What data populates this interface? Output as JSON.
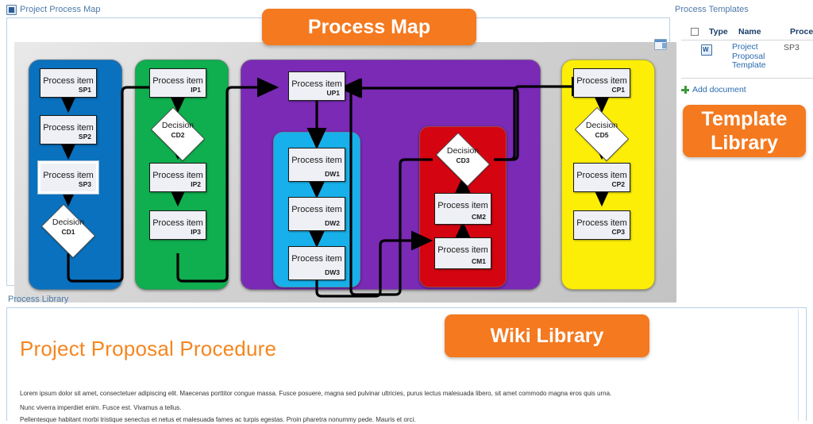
{
  "colors": {
    "accent_orange": "#f4791f",
    "lane_blue": "#0971be",
    "lane_green": "#0fae4e",
    "lane_purple": "#7a2ab5",
    "lane_cyan": "#18b0ea",
    "lane_red": "#d40511",
    "lane_yellow": "#fcee07",
    "link_blue": "#2a6ab0",
    "title_blue": "#4b7aa8"
  },
  "webparts": {
    "process_map": {
      "title": "Project Process Map",
      "icon": "document-icon",
      "panel_icon": "panel-toggle-icon"
    },
    "process_templates": {
      "title": "Process Templates"
    },
    "process_library": {
      "title": "Process Library"
    }
  },
  "callouts": {
    "process_map": "Process Map",
    "template_library": "Template\nLibrary",
    "template_library_line1": "Template",
    "template_library_line2": "Library",
    "wiki_library": "Wiki Library"
  },
  "templates_list": {
    "columns": [
      "Type",
      "Name",
      "Process"
    ],
    "select_all_checkbox": "unchecked",
    "rows": [
      {
        "type_icon": "word-document-icon",
        "name": "Project Proposal Template",
        "process": "SP3"
      }
    ],
    "add_document_label": "Add document",
    "add_document_icon": "plus-icon"
  },
  "wiki": {
    "heading": "Project Proposal Procedure",
    "paragraphs": [
      "Lorem ipsum dolor sit amet, consectetuer adipiscing elit. Maecenas porttitor congue massa. Fusce posuere, magna sed pulvinar ultricies, purus lectus malesuada libero, sit amet commodo magna eros quis urna.",
      "Nunc viverra imperdiet enim. Fusce est. Vivamus a tellus.",
      "Pellentesque habitant morbi tristique senectus et netus et malesuada fames ac turpis egestas. Proin pharetra nonummy pede. Mauris et orci."
    ]
  },
  "diagram": {
    "node_label": "Process item",
    "decision_label": "Decision",
    "lanes": [
      {
        "id": "lane-blue",
        "color": "#0971be"
      },
      {
        "id": "lane-green",
        "color": "#0fae4e"
      },
      {
        "id": "lane-purple",
        "color": "#7a2ab5"
      },
      {
        "id": "lane-cyan",
        "color": "#18b0ea"
      },
      {
        "id": "lane-red",
        "color": "#d40511"
      },
      {
        "id": "lane-yellow",
        "color": "#fcee07"
      }
    ],
    "nodes": [
      {
        "code": "SP1",
        "label": "Process item",
        "kind": "process",
        "lane": "blue",
        "selected": false
      },
      {
        "code": "SP2",
        "label": "Process item",
        "kind": "process",
        "lane": "blue",
        "selected": false
      },
      {
        "code": "SP3",
        "label": "Process item",
        "kind": "process",
        "lane": "blue",
        "selected": true
      },
      {
        "code": "CD1",
        "label": "Decision",
        "kind": "decision",
        "lane": "blue",
        "selected": false
      },
      {
        "code": "IP1",
        "label": "Process item",
        "kind": "process",
        "lane": "green",
        "selected": false
      },
      {
        "code": "CD2",
        "label": "Decision",
        "kind": "decision",
        "lane": "green",
        "selected": false
      },
      {
        "code": "IP2",
        "label": "Process item",
        "kind": "process",
        "lane": "green",
        "selected": false
      },
      {
        "code": "IP3",
        "label": "Process item",
        "kind": "process",
        "lane": "green",
        "selected": false
      },
      {
        "code": "UP1",
        "label": "Process item",
        "kind": "process",
        "lane": "purple",
        "selected": false
      },
      {
        "code": "DW1",
        "label": "Process item",
        "kind": "process",
        "lane": "cyan",
        "selected": false
      },
      {
        "code": "DW2",
        "label": "Process item",
        "kind": "process",
        "lane": "cyan",
        "selected": false
      },
      {
        "code": "DW3",
        "label": "Process item",
        "kind": "process",
        "lane": "cyan",
        "selected": false
      },
      {
        "code": "CD3",
        "label": "Decision",
        "kind": "decision",
        "lane": "red",
        "selected": false
      },
      {
        "code": "CM2",
        "label": "Process item",
        "kind": "process",
        "lane": "red",
        "selected": false
      },
      {
        "code": "CM1",
        "label": "Process item",
        "kind": "process",
        "lane": "red",
        "selected": false
      },
      {
        "code": "CP1",
        "label": "Process item",
        "kind": "process",
        "lane": "yellow",
        "selected": false
      },
      {
        "code": "CD5",
        "label": "Decision",
        "kind": "decision",
        "lane": "yellow",
        "selected": false
      },
      {
        "code": "CP2",
        "label": "Process item",
        "kind": "process",
        "lane": "yellow",
        "selected": false
      },
      {
        "code": "CP3",
        "label": "Process item",
        "kind": "process",
        "lane": "yellow",
        "selected": false
      }
    ]
  }
}
